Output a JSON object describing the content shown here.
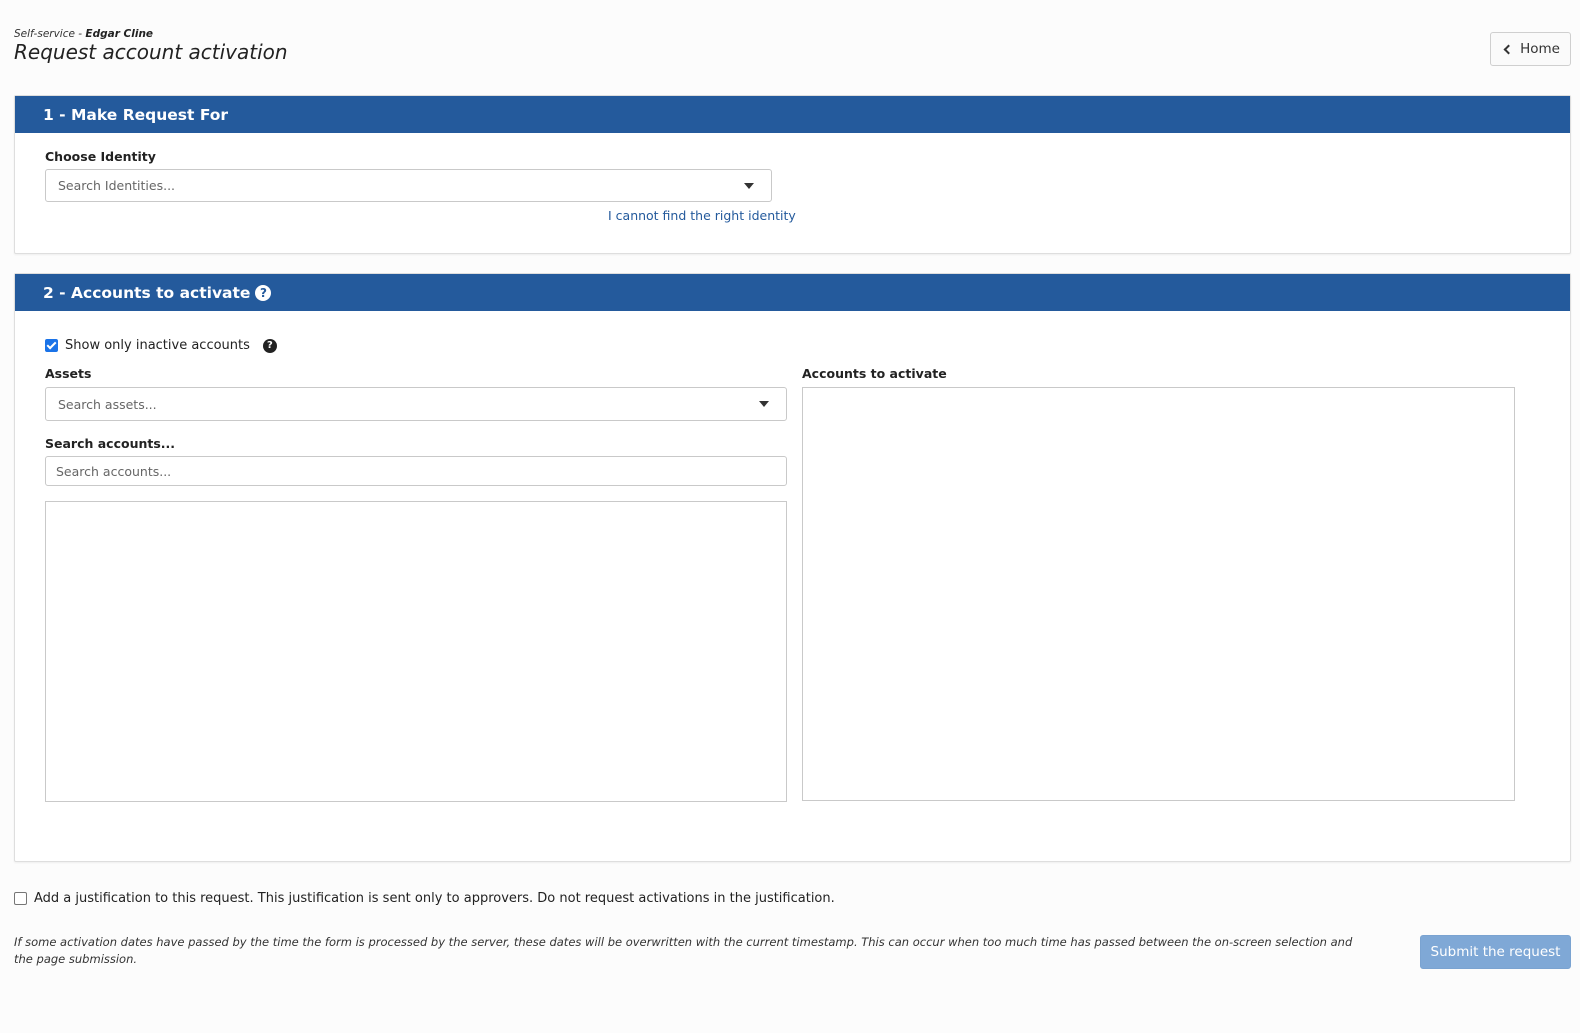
{
  "header": {
    "breadcrumb_prefix": "Self-service - ",
    "user_name": "Edgar Cline",
    "title": "Request account activation",
    "home_label": "Home"
  },
  "section1": {
    "title": "1 - Make Request For",
    "identity_label": "Choose Identity",
    "identity_placeholder": "Search Identities...",
    "cannot_find_link": "I cannot find the right identity"
  },
  "section2": {
    "title": "2 - Accounts to activate",
    "show_inactive_label": "Show only inactive accounts",
    "show_inactive_checked": true,
    "assets_label": "Assets",
    "assets_placeholder": "Search assets...",
    "search_accounts_label": "Search accounts...",
    "search_accounts_placeholder": "Search accounts...",
    "accounts_to_activate_label": "Accounts to activate"
  },
  "footer": {
    "justification_label": "Add a justification to this request. This justification is sent only to approvers. Do not request activations in the justification.",
    "justification_checked": false,
    "note": "If some activation dates have passed by the time the form is processed by the server, these dates will be overwritten with the current timestamp. This can occur when too much time has passed between the on-screen selection and the page submission.",
    "submit_label": "Submit the request"
  },
  "colors": {
    "panel_header": "#245a9c",
    "submit_button": "#7fa8d6",
    "link": "#245a9c"
  }
}
